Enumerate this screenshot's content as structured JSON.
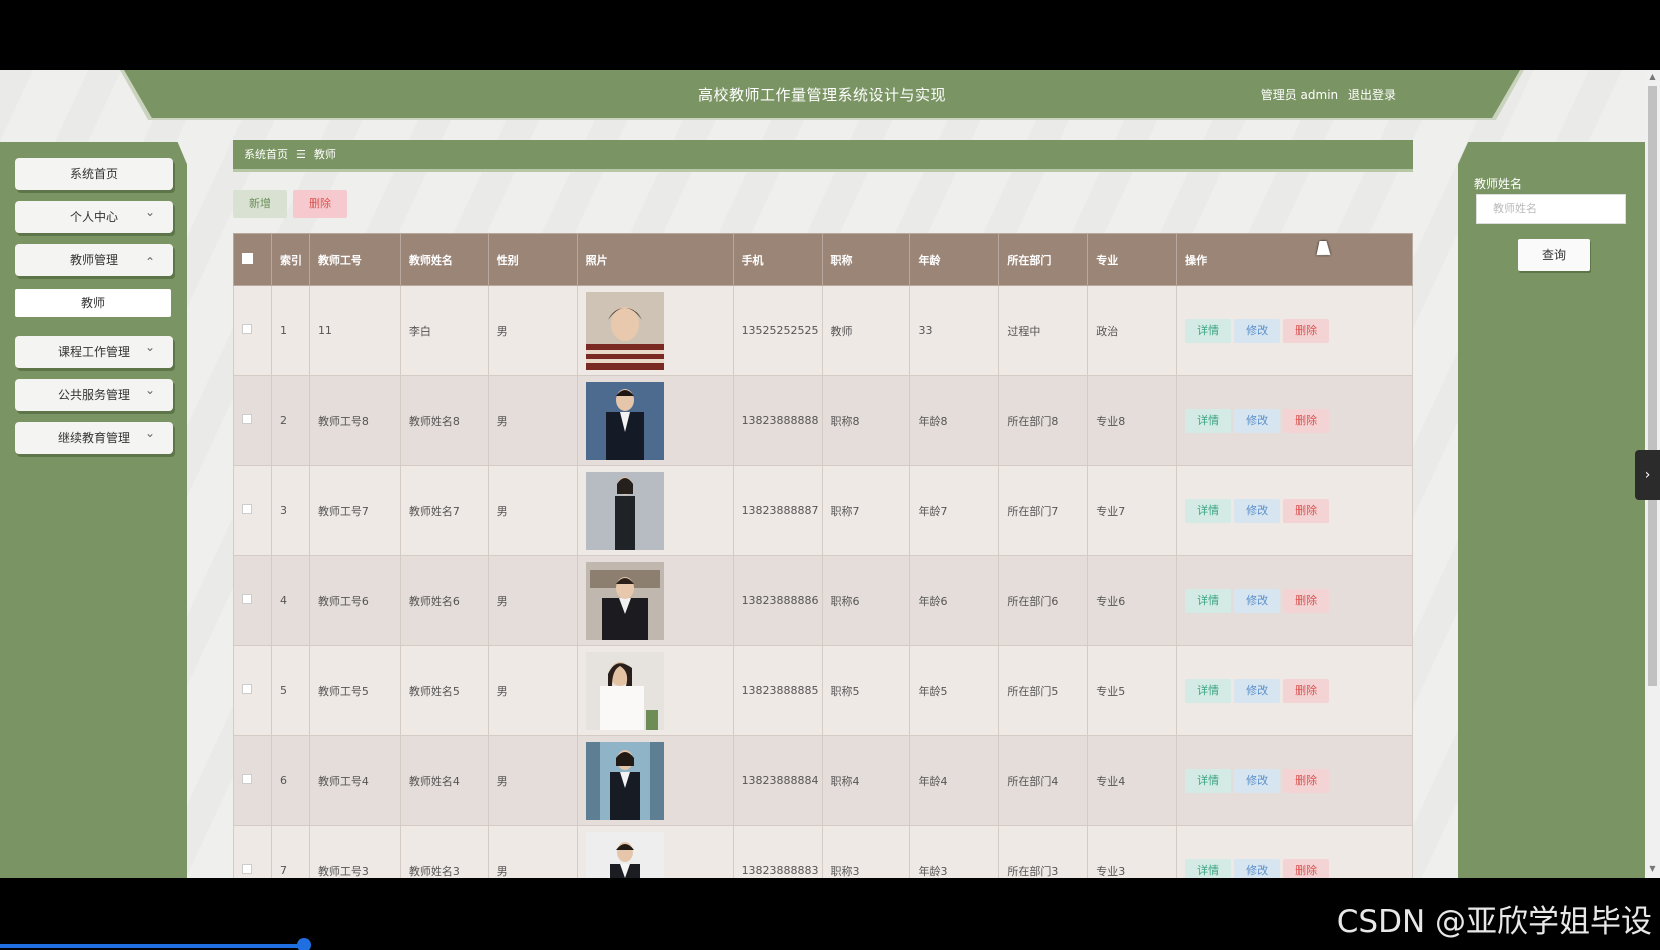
{
  "header": {
    "title": "高校教师工作量管理系统设计与实现",
    "user_label": "管理员 admin",
    "logout_label": "退出登录"
  },
  "sidebar": {
    "items": [
      {
        "label": "系统首页"
      },
      {
        "label": "个人中心",
        "chevron": "⌄"
      },
      {
        "label": "教师管理",
        "chevron": "⌃"
      },
      {
        "label": "教师"
      },
      {
        "label": "课程工作管理",
        "chevron": "⌄"
      },
      {
        "label": "公共服务管理",
        "chevron": "⌄"
      },
      {
        "label": "继续教育管理",
        "chevron": "⌄"
      }
    ]
  },
  "breadcrumb": {
    "home": "系统首页",
    "separator": "☰",
    "current": "教师"
  },
  "actions": {
    "add_label": "新增",
    "delete_label": "删除"
  },
  "table": {
    "headers": [
      "索引",
      "教师工号",
      "教师姓名",
      "性别",
      "照片",
      "手机",
      "职称",
      "年龄",
      "所在部门",
      "专业",
      "操作"
    ],
    "rows": [
      {
        "index": "1",
        "id": "11",
        "name": "李白",
        "gender": "男",
        "photo": "photo-1",
        "phone": "13525252525",
        "title": "教师",
        "age": "33",
        "dept": "过程中",
        "major": "政治"
      },
      {
        "index": "2",
        "id": "教师工号8",
        "name": "教师姓名8",
        "gender": "男",
        "photo": "photo-2",
        "phone": "13823888888",
        "title": "职称8",
        "age": "年龄8",
        "dept": "所在部门8",
        "major": "专业8"
      },
      {
        "index": "3",
        "id": "教师工号7",
        "name": "教师姓名7",
        "gender": "男",
        "photo": "photo-3",
        "phone": "13823888887",
        "title": "职称7",
        "age": "年龄7",
        "dept": "所在部门7",
        "major": "专业7"
      },
      {
        "index": "4",
        "id": "教师工号6",
        "name": "教师姓名6",
        "gender": "男",
        "photo": "photo-4",
        "phone": "13823888886",
        "title": "职称6",
        "age": "年龄6",
        "dept": "所在部门6",
        "major": "专业6"
      },
      {
        "index": "5",
        "id": "教师工号5",
        "name": "教师姓名5",
        "gender": "男",
        "photo": "photo-5",
        "phone": "13823888885",
        "title": "职称5",
        "age": "年龄5",
        "dept": "所在部门5",
        "major": "专业5"
      },
      {
        "index": "6",
        "id": "教师工号4",
        "name": "教师姓名4",
        "gender": "男",
        "photo": "photo-6",
        "phone": "13823888884",
        "title": "职称4",
        "age": "年龄4",
        "dept": "所在部门4",
        "major": "专业4"
      },
      {
        "index": "7",
        "id": "教师工号3",
        "name": "教师姓名3",
        "gender": "男",
        "photo": "photo-7",
        "phone": "13823888883",
        "title": "职称3",
        "age": "年龄3",
        "dept": "所在部门3",
        "major": "专业3"
      }
    ],
    "ops": {
      "detail": "详情",
      "edit": "修改",
      "delete": "删除"
    }
  },
  "search": {
    "label": "教师姓名",
    "placeholder": "教师姓名",
    "button": "查询"
  },
  "watermark": "CSDN @亚欣学姐毕设",
  "colors": {
    "theme_green": "#7a9463",
    "table_header": "#9b8577"
  }
}
